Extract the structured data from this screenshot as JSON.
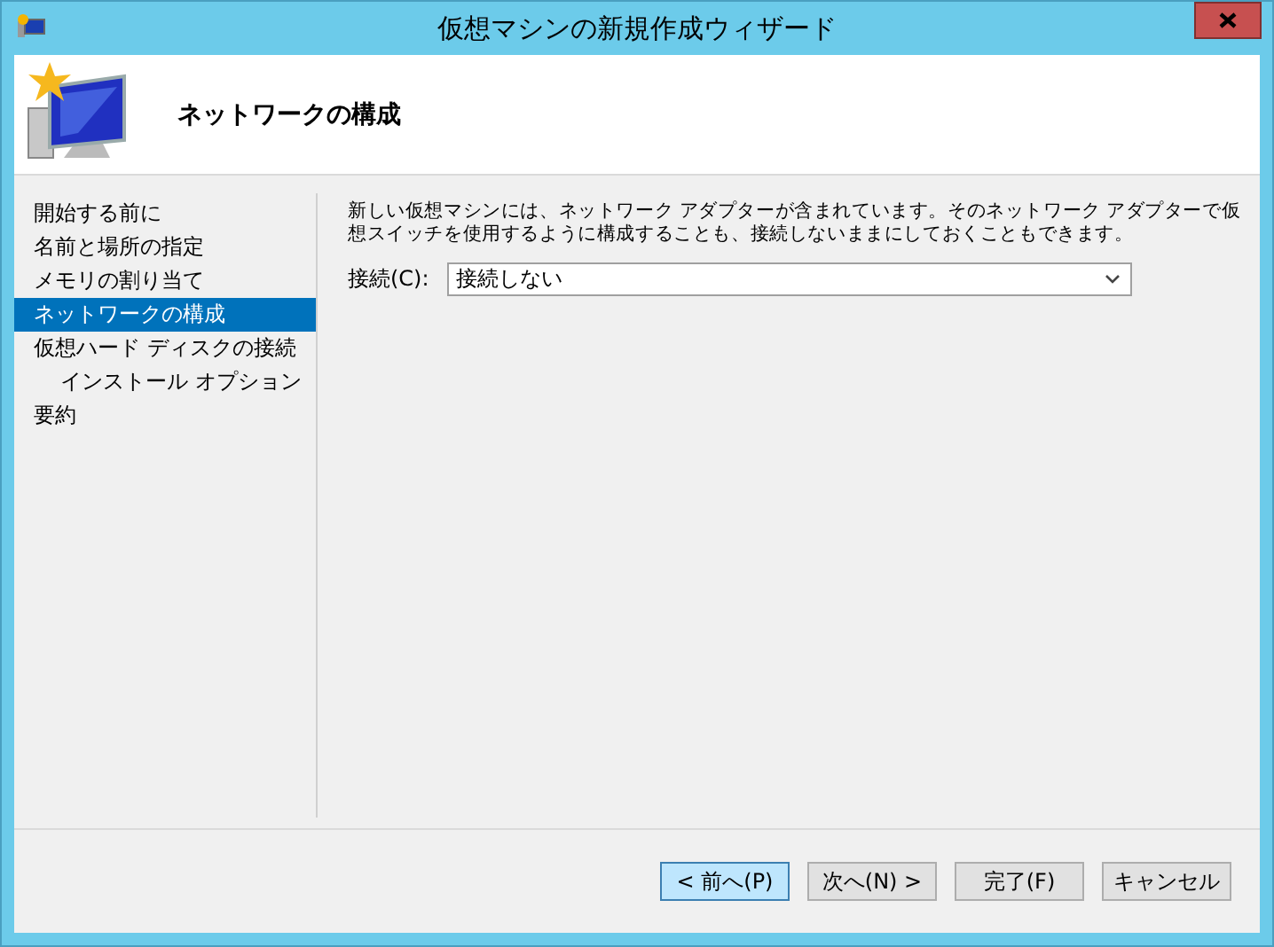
{
  "window": {
    "title": "仮想マシンの新規作成ウィザード"
  },
  "header": {
    "title": "ネットワークの構成"
  },
  "steps": [
    {
      "label": "開始する前に",
      "selected": false
    },
    {
      "label": "名前と場所の指定",
      "selected": false
    },
    {
      "label": "メモリの割り当て",
      "selected": false
    },
    {
      "label": "ネットワークの構成",
      "selected": true
    },
    {
      "label": "仮想ハード ディスクの接続",
      "selected": false,
      "children": [
        {
          "label": "インストール オプション",
          "selected": false
        }
      ]
    },
    {
      "label": "要約",
      "selected": false
    }
  ],
  "description": "新しい仮想マシンには、ネットワーク アダプターが含まれています。そのネットワーク アダプターで仮想スイッチを使用するように構成することも、接続しないままにしておくこともできます。",
  "connection": {
    "label": "接続(C):",
    "value": "接続しない"
  },
  "buttons": [
    {
      "label": "< 前へ(P)",
      "focused": true
    },
    {
      "label": "次へ(N) >",
      "focused": false
    },
    {
      "label": "完了(F)",
      "focused": false
    },
    {
      "label": "キャンセル",
      "focused": false
    }
  ]
}
